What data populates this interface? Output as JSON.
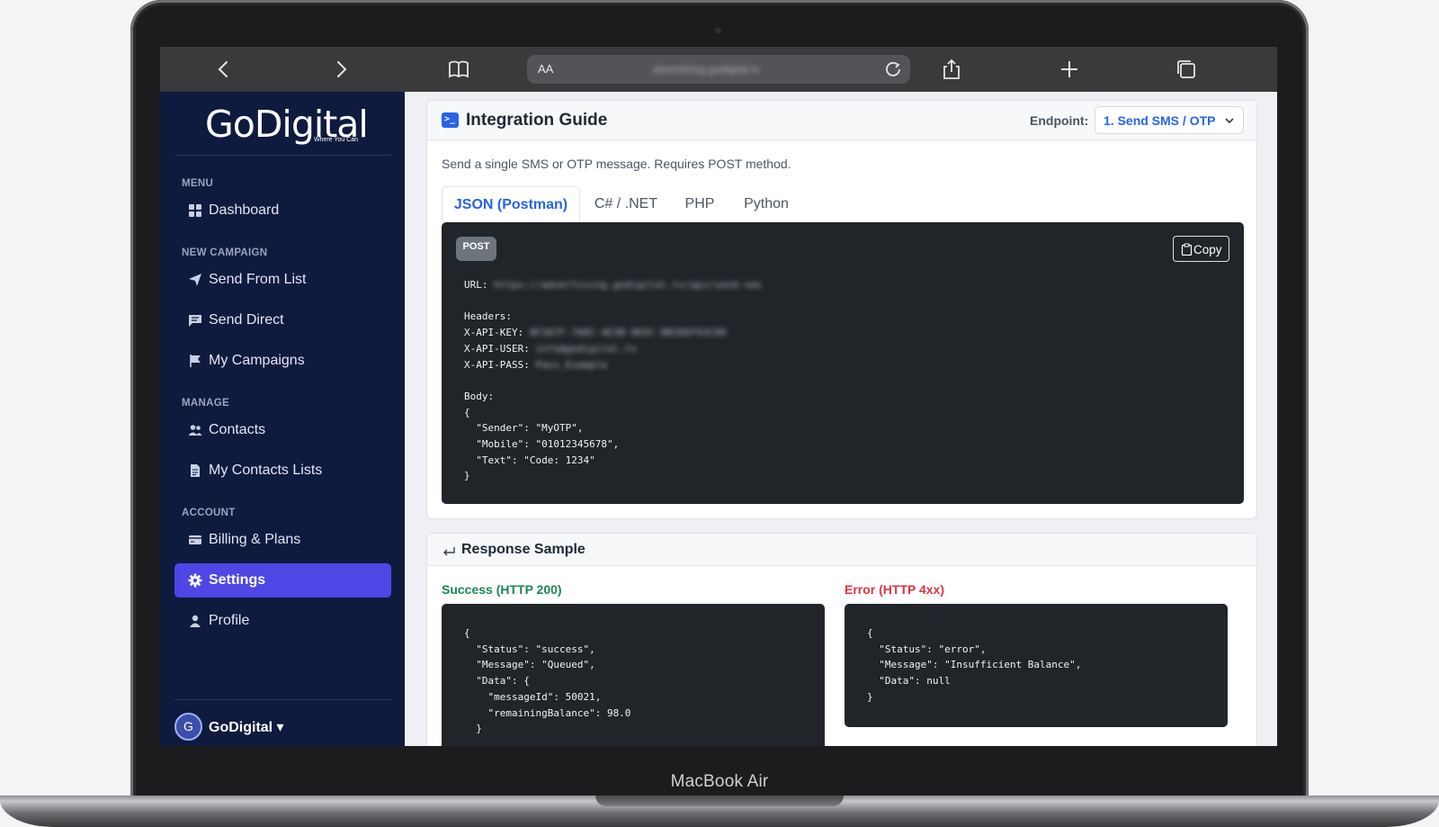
{
  "device": {
    "label": "MacBook Air"
  },
  "browser": {
    "aa_label": "AA",
    "url": "advertising.godigital.tv"
  },
  "sidebar": {
    "logo": "GoDigital",
    "logo_tagline": "Where You Can",
    "sections": {
      "menu": "MENU",
      "new_campaign": "NEW CAMPAIGN",
      "manage": "MANAGE",
      "account": "ACCOUNT"
    },
    "items": [
      {
        "label": "Dashboard",
        "icon": "grid-icon"
      },
      {
        "label": "Send From List",
        "icon": "send-icon"
      },
      {
        "label": "Send Direct",
        "icon": "message-icon"
      },
      {
        "label": "My Campaigns",
        "icon": "flag-icon"
      },
      {
        "label": "Contacts",
        "icon": "people-icon"
      },
      {
        "label": "My Contacts Lists",
        "icon": "document-icon"
      },
      {
        "label": "Billing & Plans",
        "icon": "card-icon"
      },
      {
        "label": "Settings",
        "icon": "gear-icon",
        "active": true
      },
      {
        "label": "Profile",
        "icon": "person-icon"
      }
    ],
    "user": {
      "initial": "G",
      "name": "GoDigital ▾"
    },
    "active_color": "#4f46e5",
    "background_color": "#0f1a3f"
  },
  "integration": {
    "title": "Integration Guide",
    "endpoint_label": "Endpoint:",
    "endpoint_value": "1. Send SMS / OTP",
    "description": "Send a single SMS or OTP message. Requires POST method.",
    "tabs": [
      "JSON (Postman)",
      "C# / .NET",
      "PHP",
      "Python"
    ],
    "active_tab": "JSON (Postman)",
    "method_badge": "POST",
    "copy_label": "Copy",
    "code": {
      "url_key": "URL:",
      "url_value": "https://advertising.godigital.tv/api/send-sms",
      "headers_key": "Headers:",
      "api_key_key": "X-API-KEY:",
      "api_key_value": "8F3A7F-7A8C-4E3B-9D5C-8B2DEF93C00",
      "api_user_key": "X-API-USER:",
      "api_user_value": "info@godigital.tv",
      "api_pass_key": "X-API-PASS:",
      "api_pass_value": "Pass_Example",
      "body_key": "Body:",
      "body_lines": [
        "{",
        "  \"Sender\": \"MyOTP\",",
        "  \"Mobile\": \"01012345678\",",
        "  \"Text\": \"Code: 1234\"",
        "}"
      ]
    }
  },
  "response": {
    "title": "Response Sample",
    "success_label": "Success (HTTP 200)",
    "error_label": "Error (HTTP 4xx)",
    "success_code": "{\n  \"Status\": \"success\",\n  \"Message\": \"Queued\",\n  \"Data\": {\n    \"messageId\": 50021,\n    \"remainingBalance\": 98.0\n  }",
    "error_code": "{\n  \"Status\": \"error\",\n  \"Message\": \"Insufficient Balance\",\n  \"Data\": null\n}",
    "success_color": "#198754",
    "error_color": "#dc3545"
  }
}
